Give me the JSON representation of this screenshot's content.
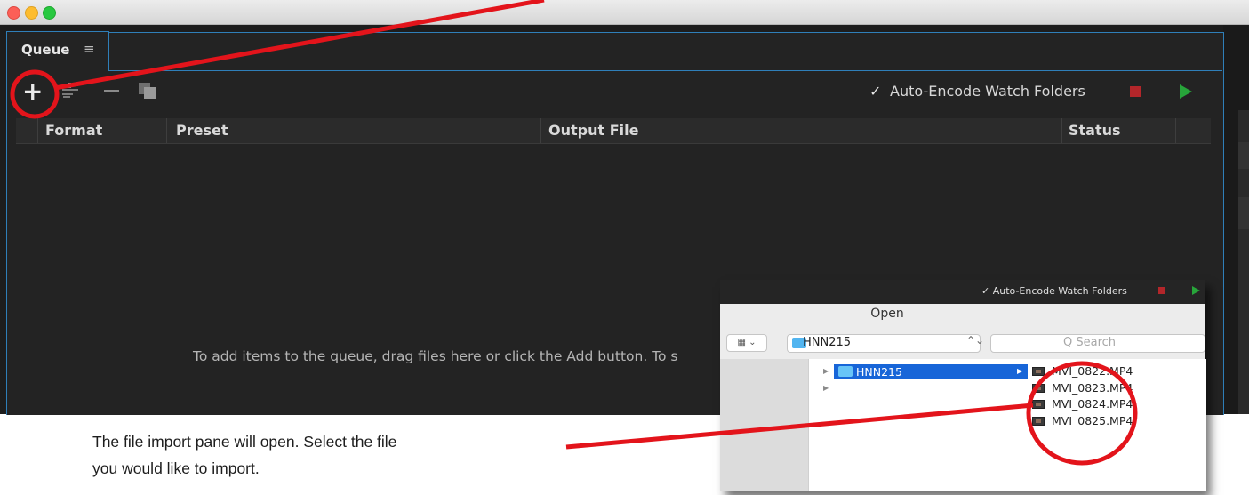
{
  "window": {
    "buttons": [
      "close",
      "minimize",
      "zoom"
    ]
  },
  "queue_tab": {
    "label": "Queue",
    "menu_icon": "hamburger-icon"
  },
  "toolbar": {
    "add_icon": "plus-icon",
    "settings_icon": "settings-icon",
    "remove_icon": "minus-icon",
    "duplicate_icon": "duplicate-icon",
    "auto_encode_check": "✓",
    "auto_encode_label": "Auto-Encode Watch Folders",
    "stop_color": "#b3262a",
    "start_color": "#27a53a"
  },
  "table": {
    "headers": [
      "Format",
      "Preset",
      "Output File",
      "Status"
    ],
    "empty_message": "To add items to the queue, drag files here or click the Add button.  To s"
  },
  "open_dialog": {
    "top_bar_label": "✓ Auto-Encode Watch Folders",
    "title": "Open",
    "view_button": "▦ ⌄",
    "location": "HNN215",
    "location_arrows": "⌃⌄",
    "search_placeholder": "Q Search",
    "selected_folder": "HNN215",
    "files": [
      "MVI_0822.MP4",
      "MVI_0823.MP4",
      "MVI_0824.MP4",
      "MVI_0825.MP4"
    ]
  },
  "annotation": {
    "caption_line1": "The file import pane will open. Select the file",
    "caption_line2": "you would like to import.",
    "highlight_color": "#e3141b"
  }
}
